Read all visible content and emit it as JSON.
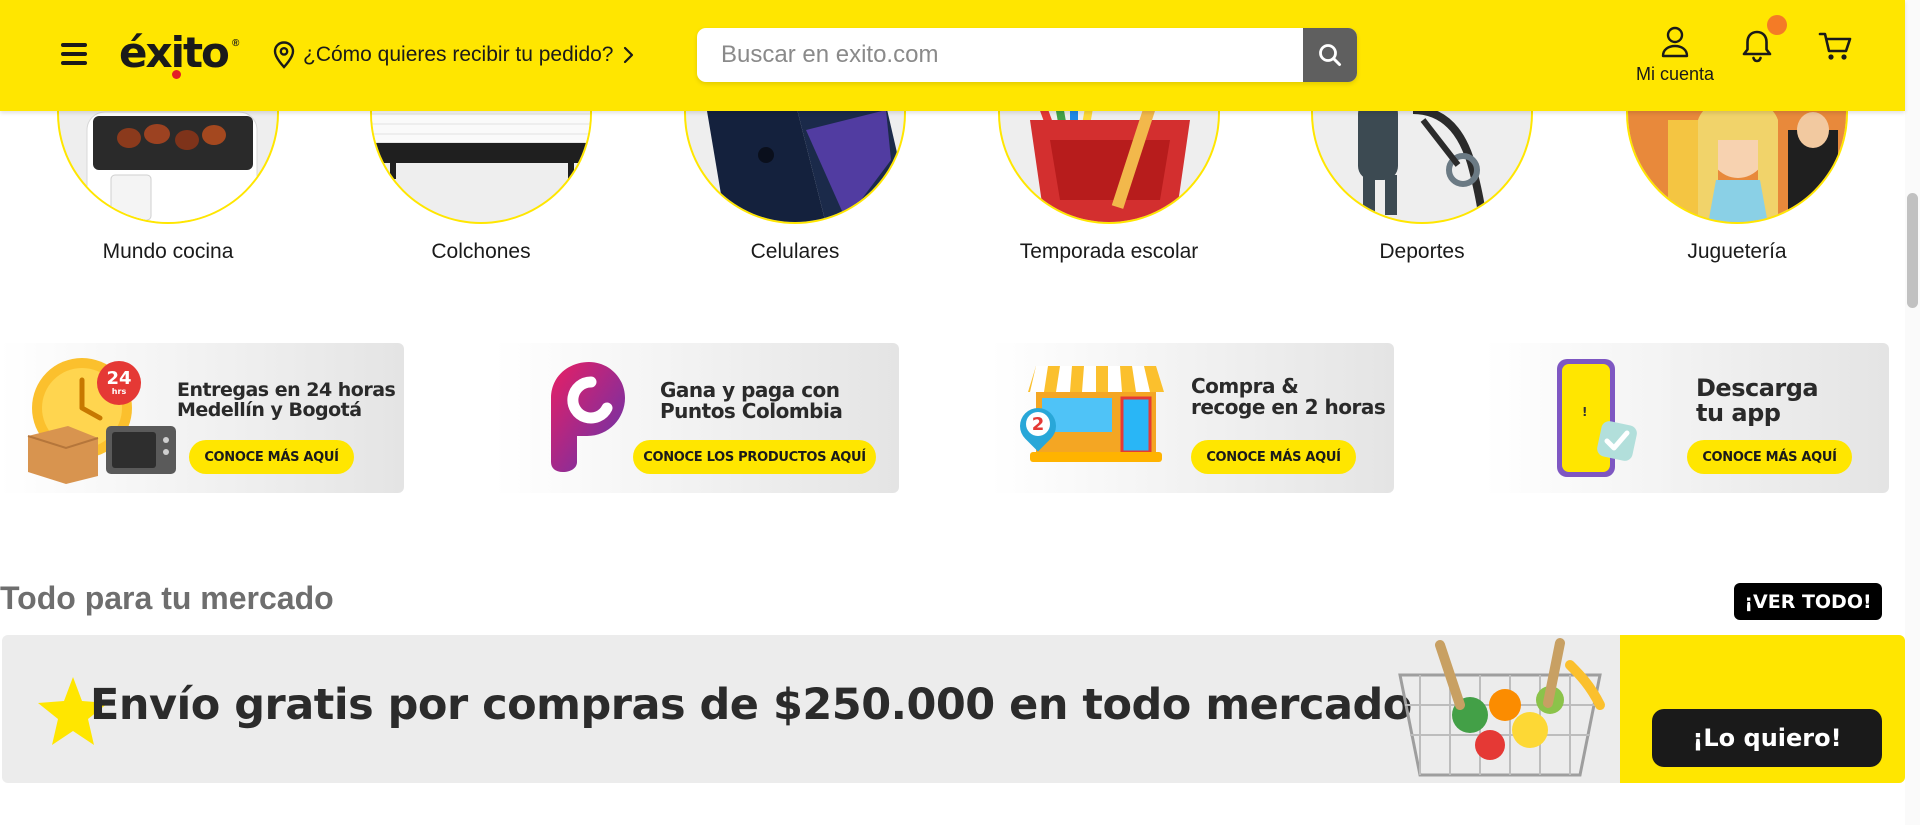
{
  "header": {
    "logo_text": "éxito",
    "logo_reg": "®",
    "delivery_prompt": "¿Cómo quieres recibir tu pedido?",
    "search_placeholder": "Buscar en exito.com",
    "account_label": "Mi cuenta"
  },
  "categories": [
    {
      "label": "Mundo cocina",
      "icon": "air-fryer"
    },
    {
      "label": "Colchones",
      "icon": "mattress"
    },
    {
      "label": "Celulares",
      "icon": "smartphone"
    },
    {
      "label": "Temporada escolar",
      "icon": "school-backpack"
    },
    {
      "label": "Deportes",
      "icon": "treadmill"
    },
    {
      "label": "Juguetería",
      "icon": "doll"
    }
  ],
  "promos": [
    {
      "title_line1": "Entregas en 24 horas",
      "title_line2": "Medellín y Bogotá",
      "badge_top": "24",
      "badge_bottom": "hrs",
      "button": "CONOCE MÁS AQUÍ"
    },
    {
      "title_line1": "Gana y paga con",
      "title_line2": "Puntos Colombia",
      "button": "CONOCE LOS PRODUCTOS AQUÍ"
    },
    {
      "title_line1": "Compra &",
      "title_line2": "recoge en 2 horas",
      "pin_number": "2",
      "button": "CONOCE MÁS AQUÍ"
    },
    {
      "title_line1": "Descarga",
      "title_line2": "tu app",
      "phone_mark": "!",
      "button": "CONOCE MÁS AQUÍ"
    }
  ],
  "mercado": {
    "title": "Todo para tu mercado",
    "see_all": "¡VER TODO!",
    "banner_text": "Envío gratis por compras de $250.000 en todo mercado",
    "banner_cta": "¡Lo quiero!"
  },
  "colors": {
    "brand_yellow": "#ffe600",
    "notification": "#f47b26",
    "logo_dot": "#e31f26",
    "search_button": "#5f5f5f"
  }
}
